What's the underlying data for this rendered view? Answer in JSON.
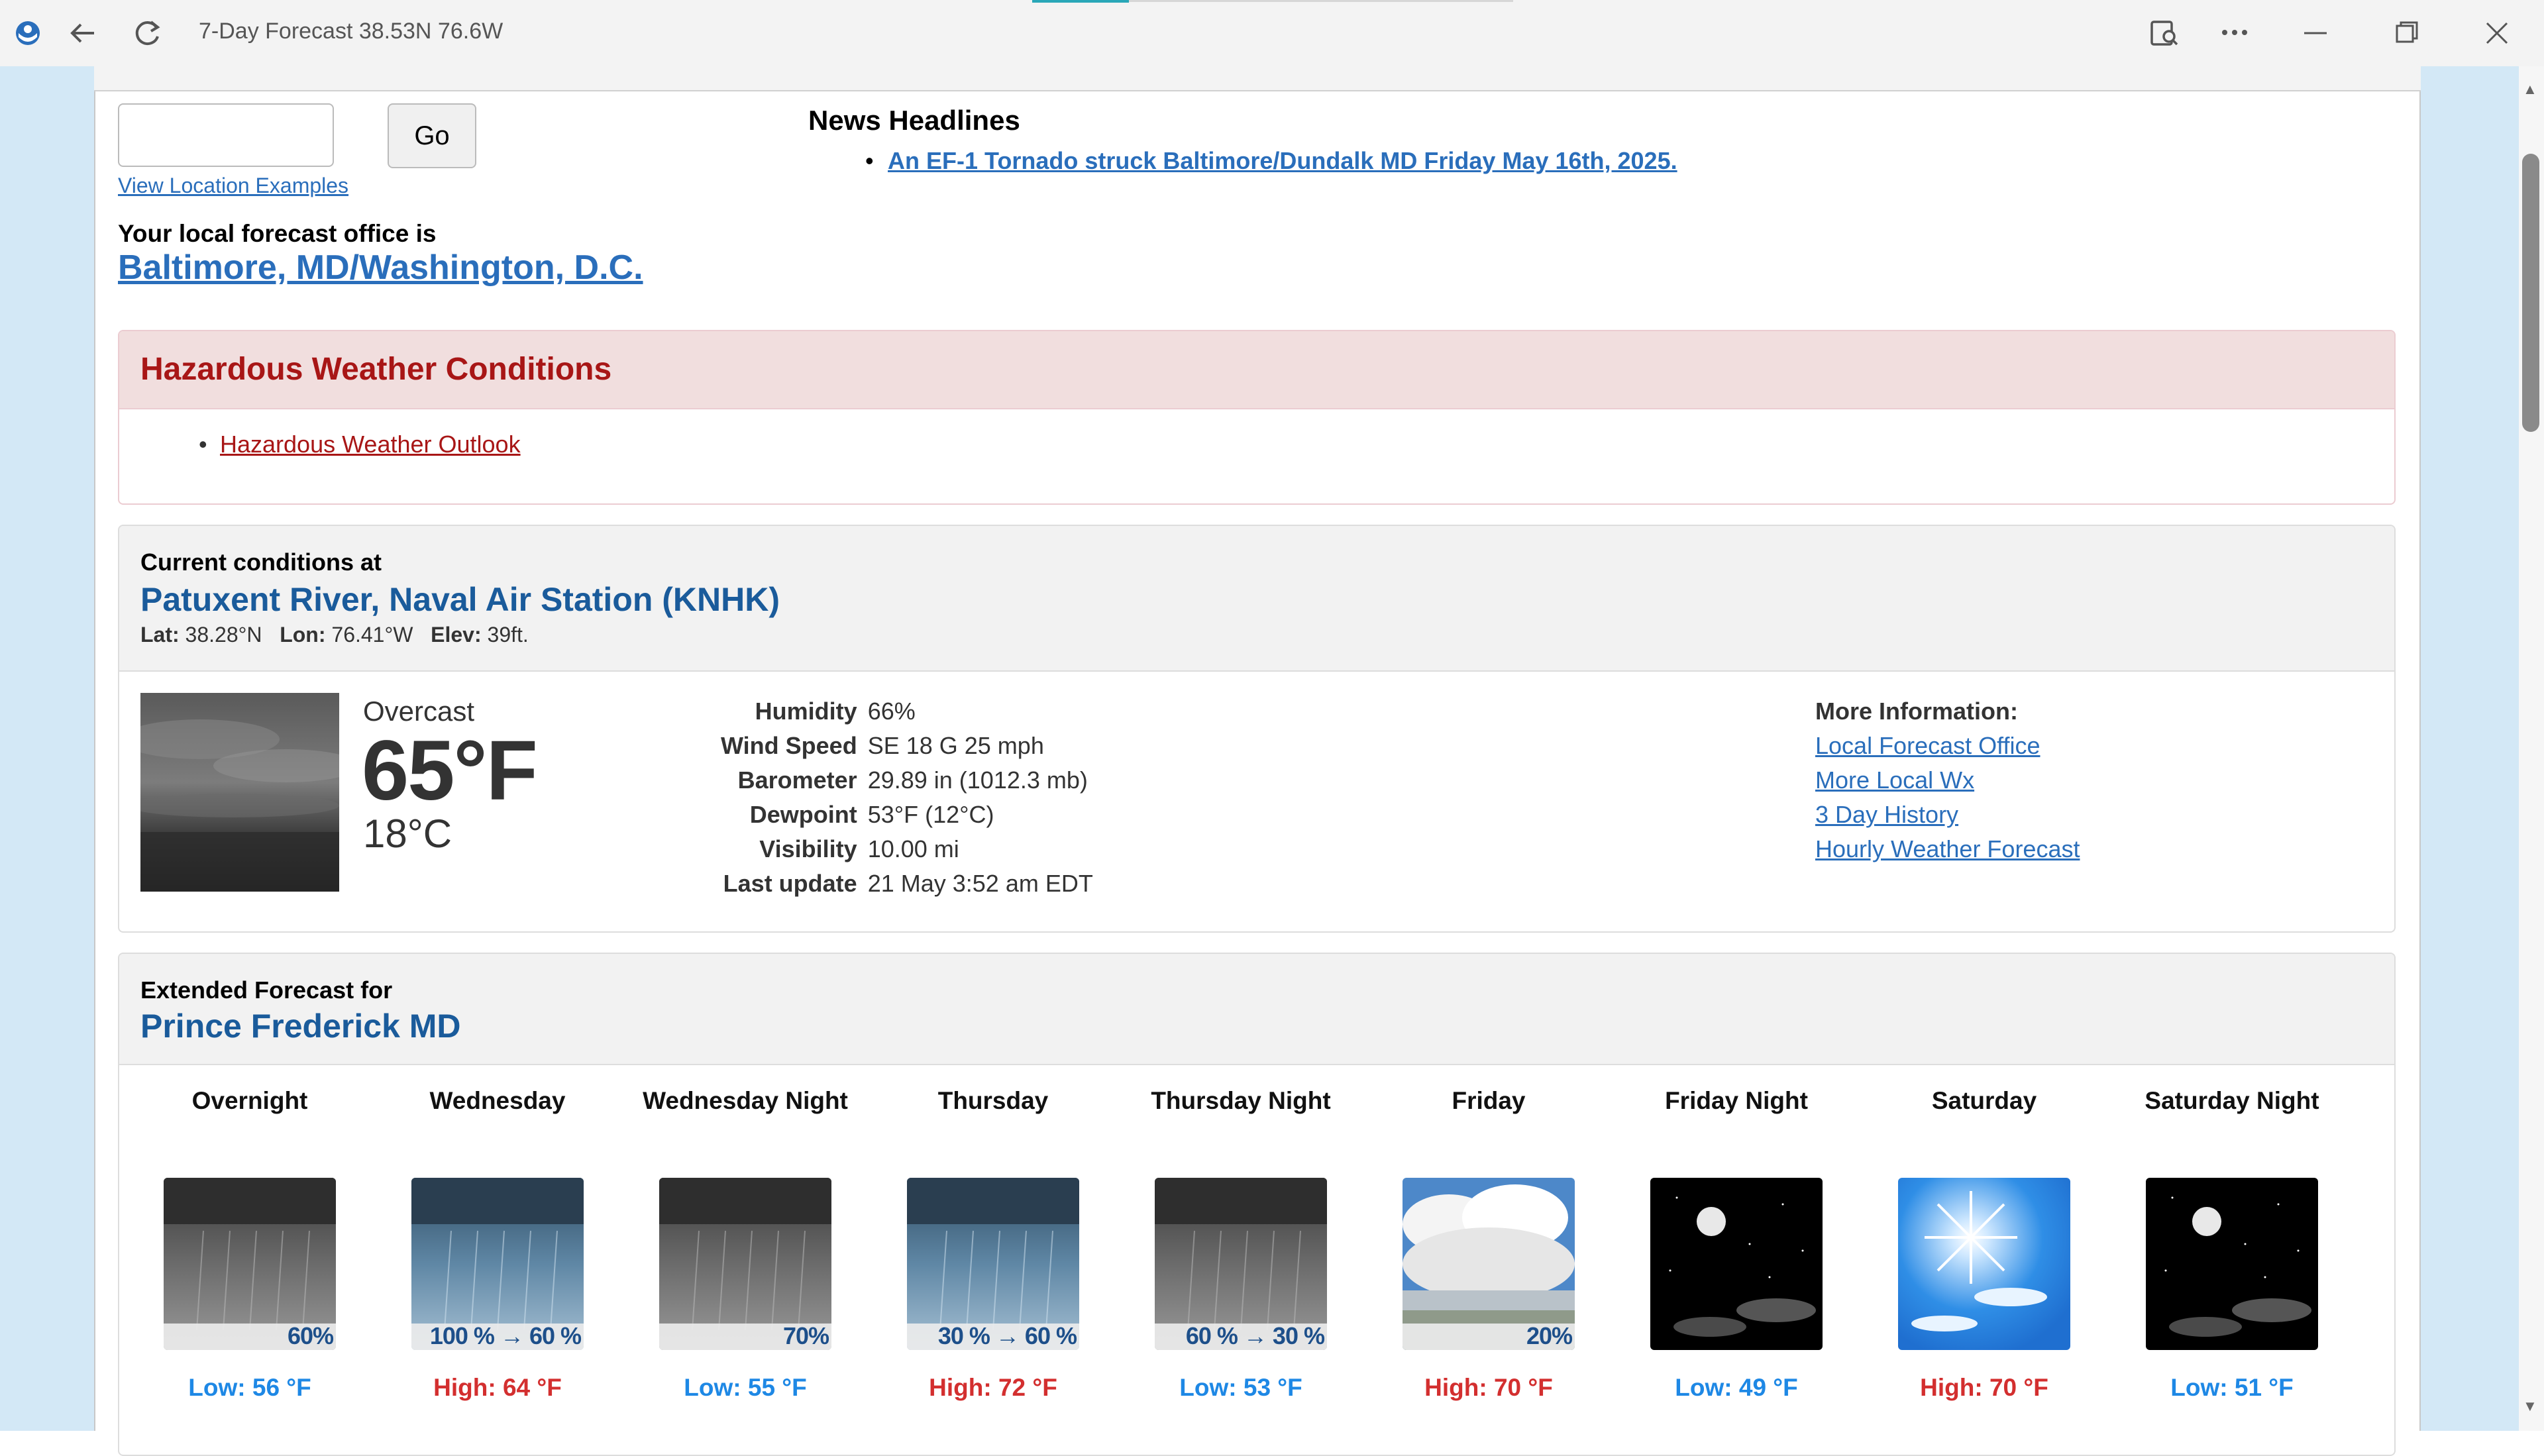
{
  "window": {
    "title": "7-Day Forecast 38.53N 76.6W",
    "icons": [
      "browser-logo-icon",
      "back-icon",
      "refresh-icon",
      "read-aloud-icon",
      "more-icon",
      "minimize-icon",
      "restore-icon",
      "close-icon"
    ]
  },
  "search": {
    "input_value": "",
    "go_label": "Go",
    "examples_link": "View Location Examples"
  },
  "office": {
    "label": "Your local forecast office is",
    "link": "Baltimore, MD/Washington, D.C."
  },
  "news": {
    "title": "News Headlines",
    "items": [
      "An EF-1 Tornado struck Baltimore/Dundalk MD Friday May 16th, 2025."
    ]
  },
  "hazard": {
    "title": "Hazardous Weather Conditions",
    "items": [
      "Hazardous Weather Outlook"
    ],
    "color": "#a81616"
  },
  "current": {
    "label": "Current conditions at",
    "station": "Patuxent River, Naval Air Station (KNHK)",
    "lat_label": "Lat:",
    "lat": "38.28°N",
    "lon_label": "Lon:",
    "lon": "76.41°W",
    "elev_label": "Elev:",
    "elev": "39ft.",
    "condition": "Overcast",
    "temp_f": "65°F",
    "temp_c": "18°C",
    "details": [
      {
        "label": "Humidity",
        "value": "66%"
      },
      {
        "label": "Wind Speed",
        "value": "SE 18 G 25 mph"
      },
      {
        "label": "Barometer",
        "value": "29.89 in (1012.3 mb)"
      },
      {
        "label": "Dewpoint",
        "value": "53°F (12°C)"
      },
      {
        "label": "Visibility",
        "value": "10.00 mi"
      },
      {
        "label": "Last update",
        "value": "21 May 3:52 am EDT"
      }
    ],
    "more_info": {
      "title": "More Information:",
      "links": [
        "Local Forecast Office",
        "More Local Wx",
        "3 Day History",
        "Hourly Weather Forecast"
      ]
    }
  },
  "forecast": {
    "label": "Extended Forecast for",
    "place": "Prince Frederick MD",
    "periods": [
      {
        "name": "Overnight",
        "pop": "60%",
        "temp": "Low: 56 °F",
        "kind": "lo",
        "icon": "rain-night"
      },
      {
        "name": "Wednesday",
        "pop": "100 % → 60 %",
        "temp": "High: 64 °F",
        "kind": "hi",
        "icon": "rain-day"
      },
      {
        "name": "Wednesday Night",
        "pop": "70%",
        "temp": "Low: 55 °F",
        "kind": "lo",
        "icon": "rain-night"
      },
      {
        "name": "Thursday",
        "pop": "30 % → 60 %",
        "temp": "High: 72 °F",
        "kind": "hi",
        "icon": "rain-day"
      },
      {
        "name": "Thursday Night",
        "pop": "60 % → 30 %",
        "temp": "Low: 53 °F",
        "kind": "lo",
        "icon": "rain-night"
      },
      {
        "name": "Friday",
        "pop": "20%",
        "temp": "High: 70 °F",
        "kind": "hi",
        "icon": "shower-cloud-day"
      },
      {
        "name": "Friday Night",
        "pop": "",
        "temp": "Low: 49 °F",
        "kind": "lo",
        "icon": "clear-night"
      },
      {
        "name": "Saturday",
        "pop": "",
        "temp": "High: 70 °F",
        "kind": "hi",
        "icon": "sunny"
      },
      {
        "name": "Saturday Night",
        "pop": "",
        "temp": "Low: 51 °F",
        "kind": "lo",
        "icon": "clear-night"
      }
    ]
  }
}
